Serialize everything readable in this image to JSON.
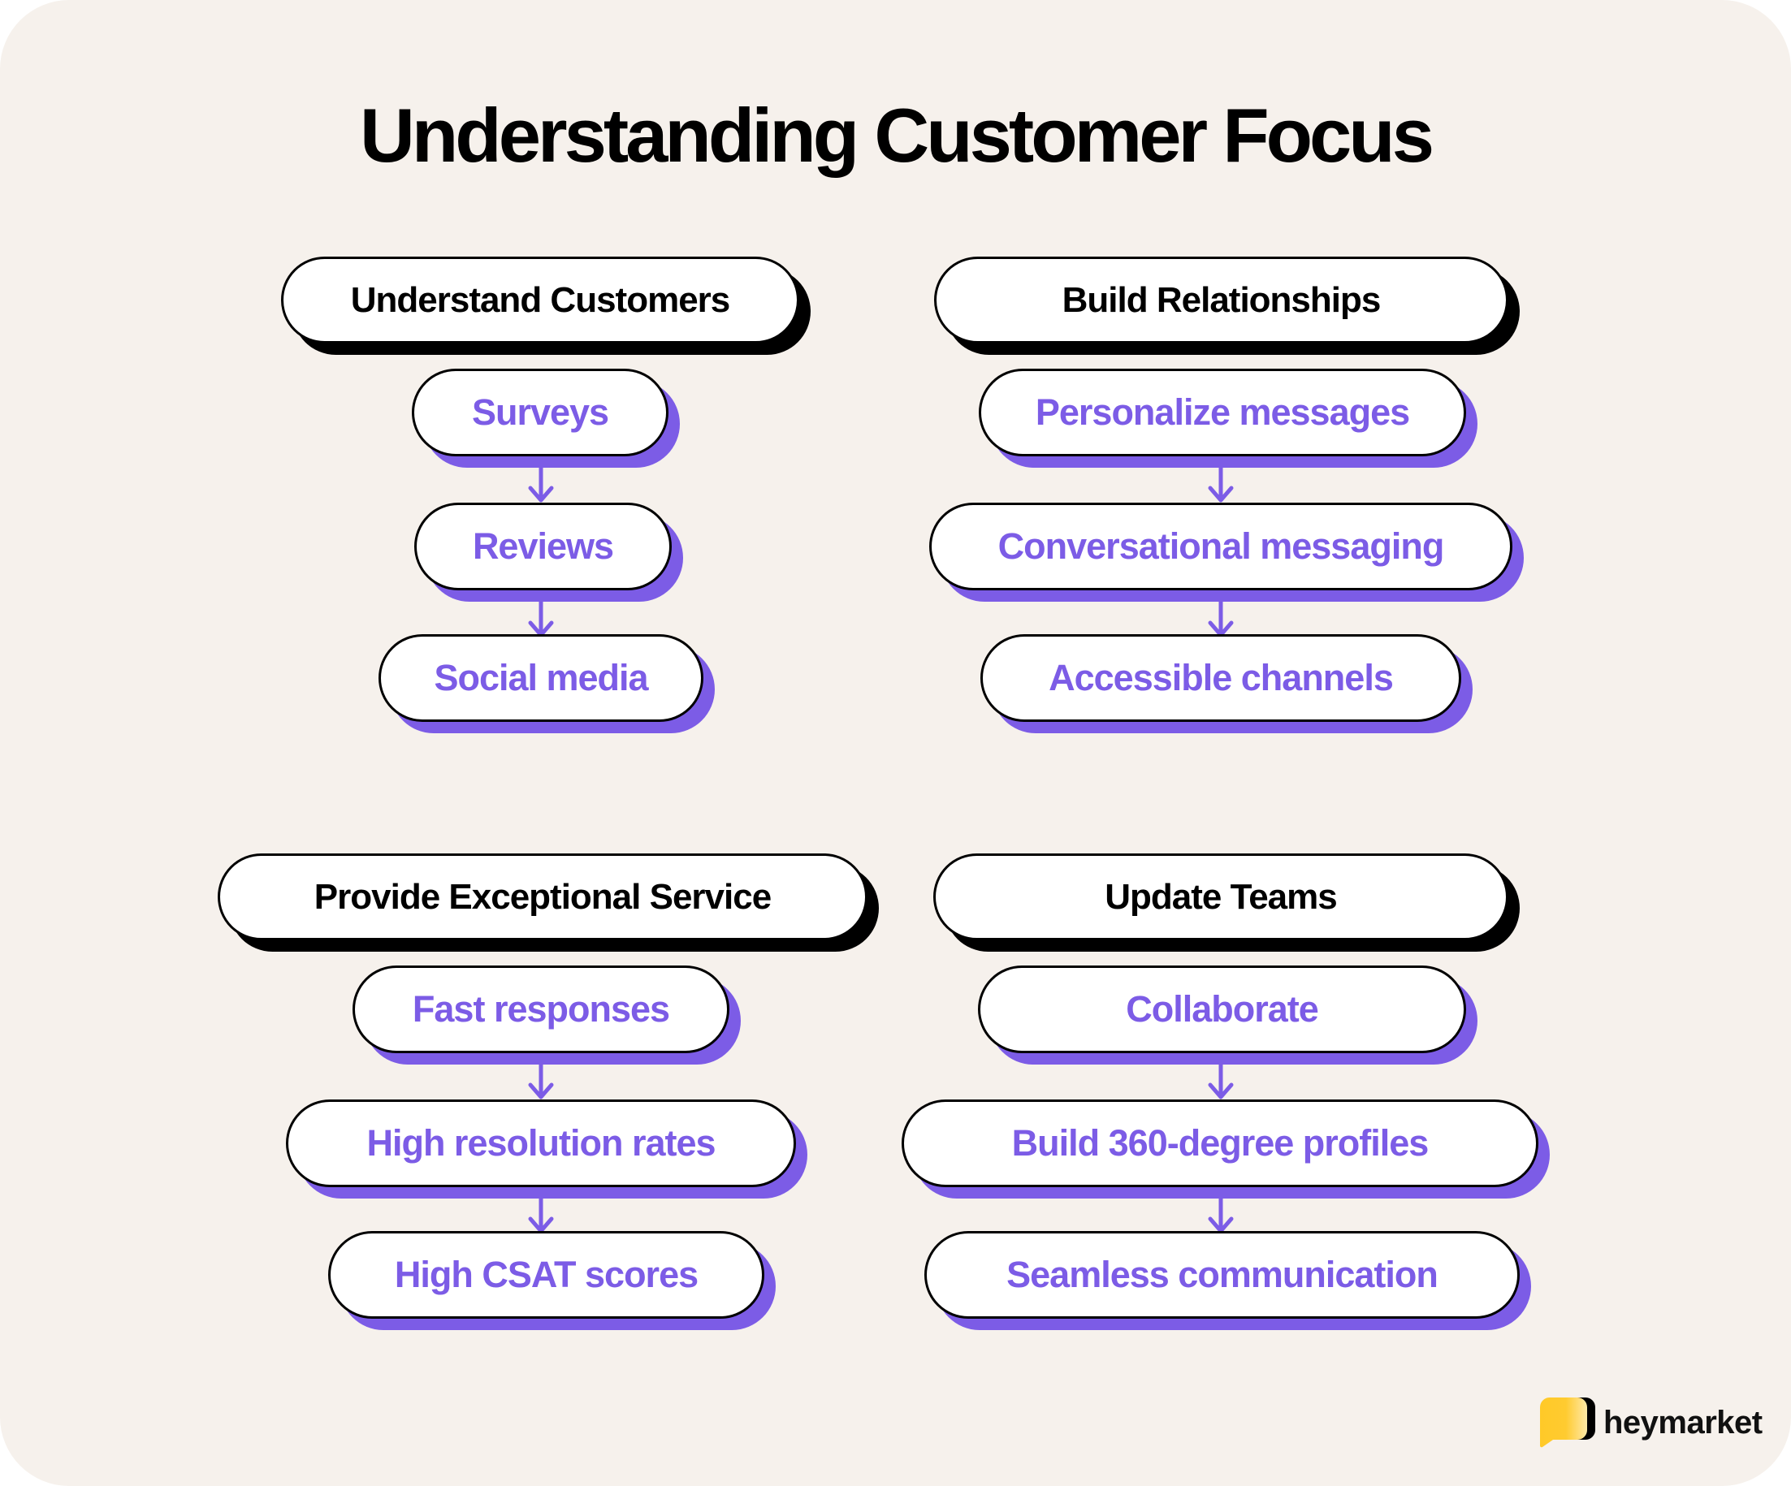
{
  "title": "Understanding Customer Focus",
  "colors": {
    "background": "#f6f1ec",
    "accent": "#7c5ce6",
    "heading_shadow": "#000000",
    "logo_yellow": "#ffc928"
  },
  "groups": [
    {
      "heading": "Understand Customers",
      "steps": [
        "Surveys",
        "Reviews",
        "Social media"
      ]
    },
    {
      "heading": "Build Relationships",
      "steps": [
        "Personalize messages",
        "Conversational messaging",
        "Accessible channels"
      ]
    },
    {
      "heading": "Provide Exceptional Service",
      "steps": [
        "Fast responses",
        "High resolution rates",
        "High CSAT scores"
      ]
    },
    {
      "heading": "Update Teams",
      "steps": [
        "Collaborate",
        "Build 360-degree profiles",
        "Seamless communication"
      ]
    }
  ],
  "icons": {
    "arrow": "arrow-down-icon",
    "logo": "chat-bubble-logo-icon"
  },
  "brand": {
    "name": "heymarket"
  }
}
